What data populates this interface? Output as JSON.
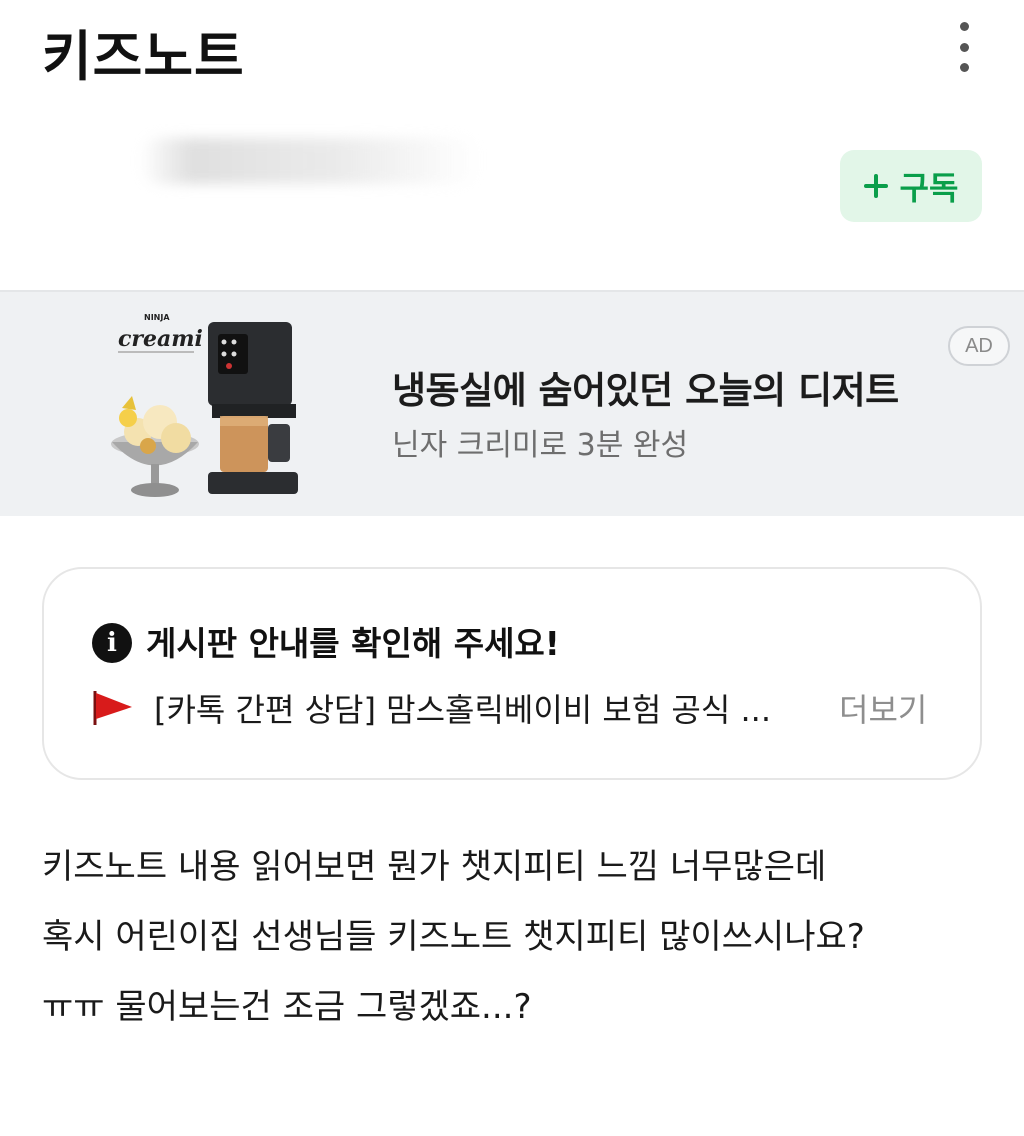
{
  "header": {
    "title": "키즈노트",
    "more_icon": "more-vertical-icon"
  },
  "subscribe": {
    "icon": "plus-icon",
    "label": "구독",
    "color": "#0a9e4a",
    "background": "#e2f6e8"
  },
  "ad": {
    "brand_top": "NINJA",
    "brand_name": "creami",
    "headline": "냉동실에 숨어있던 오늘의 디저트",
    "subtext": "닌자 크리미로 3분 완성",
    "badge": "AD"
  },
  "notice": {
    "icon": "info-icon",
    "title": "게시판 안내를 확인해 주세요!",
    "flag_icon": "red-flag-icon",
    "item_text": "[카톡 간편 상담] 맘스홀릭베이비 보험 공식 ...",
    "more_label": "더보기"
  },
  "post": {
    "lines": [
      "키즈노트 내용 읽어보면 뭔가 챗지피티 느낌 너무많은데",
      "혹시 어린이집 선생님들 키즈노트 챗지피티 많이쓰시나요?",
      "ㅠㅠ 물어보는건 조금 그렇겠죠...?"
    ]
  }
}
